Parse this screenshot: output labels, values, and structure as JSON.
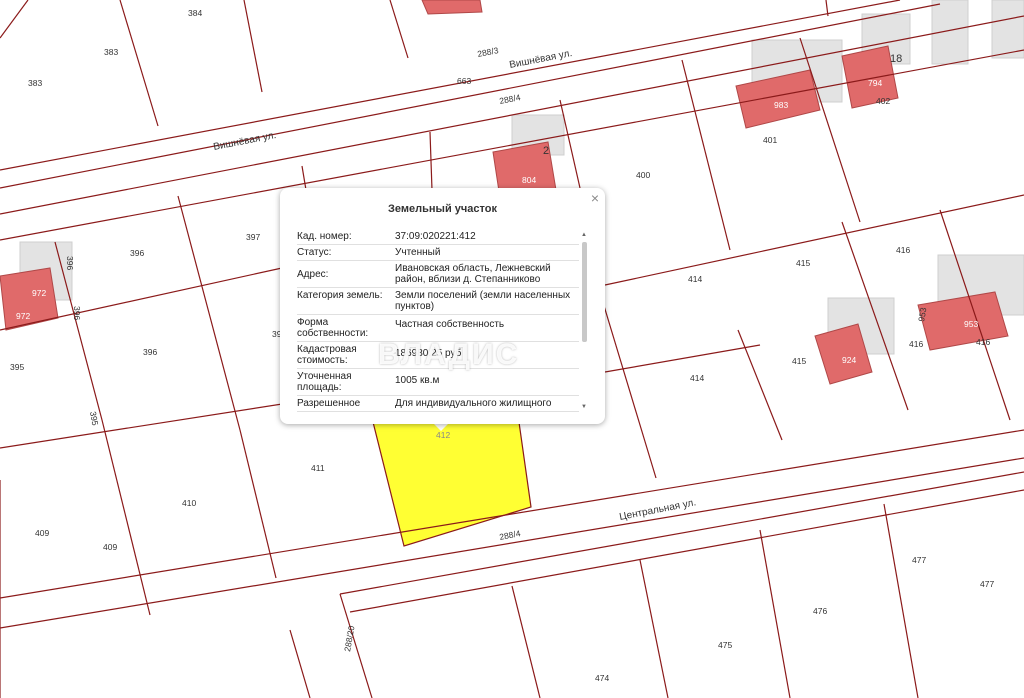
{
  "map": {
    "streets": {
      "vishnevaya_1": "Вишнёвая ул.",
      "vishnevaya_2": "Вишнёвая ул.",
      "centralnaya": "Центральная ул."
    },
    "parcel_labels": {
      "p384": "384",
      "p383a": "383",
      "p383b": "383",
      "p663": "663",
      "p288_3": "288/3",
      "p288_4a": "288/4",
      "p288_4b": "288/4",
      "p288_20": "288/20",
      "p400": "400",
      "p401": "401",
      "p402": "402",
      "p983": "983",
      "p794": "794",
      "p18": "18",
      "p804": "804",
      "p12": "2",
      "p397": "397",
      "p396a": "396",
      "p396b": "396",
      "p396c": "396",
      "p396d": "396",
      "p395a": "395",
      "p395b": "395",
      "p39x": "39",
      "p972a": "972",
      "p972b": "972",
      "p416a": "416",
      "p416b": "416",
      "p416c": "416",
      "p953a": "953",
      "p953b": "953",
      "p415a": "415",
      "p415b": "415",
      "p414a": "414",
      "p414b": "414",
      "p924": "924",
      "p412": "412",
      "p411": "411",
      "p410": "410",
      "p409a": "409",
      "p409b": "409",
      "p477a": "477",
      "p477b": "477",
      "p476": "476",
      "p475": "475",
      "p474": "474"
    },
    "colors": {
      "boundary": "#8b1a1a",
      "building": "#e06a6a",
      "building_gray": "#e2e2e2",
      "selected_parcel": "#ffff33"
    }
  },
  "popup": {
    "title": "Земельный участок",
    "rows": [
      {
        "label": "Кад. номер:",
        "value": "37:09:020221:412"
      },
      {
        "label": "Статус:",
        "value": "Учтенный"
      },
      {
        "label": "Адрес:",
        "value": "Ивановская область, Лежневский район, вблизи д. Степанниково"
      },
      {
        "label": "Категория земель:",
        "value": "Земли поселений (земли населенных пунктов)"
      },
      {
        "label": "Форма собственности:",
        "value": "Частная собственность"
      },
      {
        "label": "Кадастровая стоимость:",
        "value": "186980.25 руб"
      },
      {
        "label": "Уточненная площадь:",
        "value": "1005 кв.м"
      },
      {
        "label": "Разрешенное",
        "value": "Для индивидуального жилищного"
      }
    ],
    "close_icon": "close-icon",
    "watermark": "ВЛАДИС"
  }
}
